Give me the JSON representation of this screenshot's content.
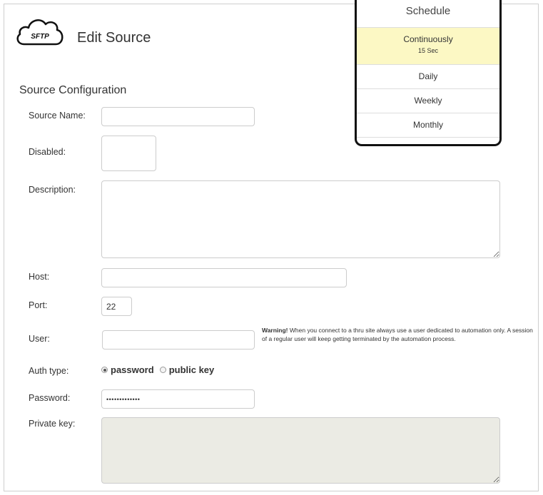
{
  "header": {
    "logo_text": "SFTP",
    "title": "Edit Source"
  },
  "section": {
    "title": "Source Configuration"
  },
  "form": {
    "source_name": {
      "label": "Source Name:",
      "value": ""
    },
    "disabled": {
      "label": "Disabled:"
    },
    "description": {
      "label": "Description:",
      "value": ""
    },
    "host": {
      "label": "Host:",
      "value": ""
    },
    "port": {
      "label": "Port:",
      "value": "22"
    },
    "user": {
      "label": "User:",
      "value": ""
    },
    "warning": {
      "strong": "Warning!",
      "text": " When you connect to a thru site always use a user dedicated to automation only. A session of a regular user will keep getting terminated by the automation process."
    },
    "auth_type": {
      "label": "Auth type:",
      "options": [
        "password",
        "public key"
      ],
      "selected": "password"
    },
    "password": {
      "label": "Password:",
      "value": "•••••••••••••"
    },
    "private_key": {
      "label": "Private key:",
      "value": ""
    }
  },
  "schedule": {
    "title": "Schedule",
    "items": [
      {
        "label": "Continuously",
        "sub": "15 Sec",
        "active": true
      },
      {
        "label": "Daily"
      },
      {
        "label": "Weekly"
      },
      {
        "label": "Monthly"
      }
    ]
  },
  "colors": {
    "active_item_bg": "#fcf8c4",
    "disabled_textarea_bg": "#ebebe4"
  }
}
